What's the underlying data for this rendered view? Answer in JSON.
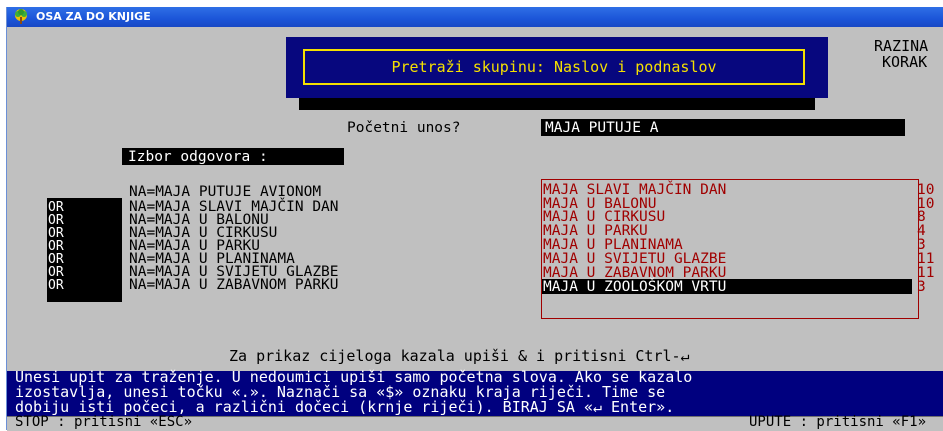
{
  "window": {
    "title": "OSA ZA DO KNJIGE"
  },
  "header": {
    "title": "Pretraži skupinu: Naslov i podnaslov",
    "right_label_1": "RAZINA",
    "right_label_2": "KORAK"
  },
  "input": {
    "label": "Početni unos?",
    "value": "MAJA PUTUJE A"
  },
  "choice": {
    "title": "Izbor odgovora :"
  },
  "terms": [
    {
      "op": "",
      "text": "NA=MAJA PUTUJE AVIONOM"
    },
    {
      "op": "OR",
      "text": "NA=MAJA SLAVI MAJČIN DAN"
    },
    {
      "op": "OR",
      "text": "NA=MAJA U BALONU"
    },
    {
      "op": "OR",
      "text": "NA=MAJA U CIRKUSU"
    },
    {
      "op": "OR",
      "text": "NA=MAJA U PARKU"
    },
    {
      "op": "OR",
      "text": "NA=MAJA U PLANINAMA"
    },
    {
      "op": "OR",
      "text": "NA=MAJA U SVIJETU GLAZBE"
    },
    {
      "op": "OR",
      "text": "NA=MAJA U ZABAVNOM PARKU"
    }
  ],
  "results": [
    {
      "title": "MAJA SLAVI MAJČIN DAN",
      "count": "10"
    },
    {
      "title": "MAJA U BALONU",
      "count": "10"
    },
    {
      "title": "MAJA U CIRKUSU",
      "count": "8"
    },
    {
      "title": "MAJA U PARKU",
      "count": "4"
    },
    {
      "title": "MAJA U PLANINAMA",
      "count": "3"
    },
    {
      "title": "MAJA U SVIJETU GLAZBE",
      "count": "11"
    },
    {
      "title": "MAJA U ZABAVNOM PARKU",
      "count": "11"
    },
    {
      "title": "MAJA U ZOOLOŠKOM VRTU",
      "count": "3"
    }
  ],
  "hint": "Za prikaz cijeloga kazala upiši & i pritisni Ctrl-↵",
  "help": {
    "line1": "Unesi upit za traženje. U nedoumici upiši samo početna slova. Ako se kazalo",
    "line2": "izostavlja, unesi točku «.». Naznači sa «$» oznaku kraja riječi. Time se",
    "line3": "dobiju isti počeci, a različni dočeci (krnje riječi). BIRAJ SA «↵ Enter»."
  },
  "footer": {
    "left": "STOP : pritisni «ESC»",
    "right": "UPUTE : pritisni «F1»"
  },
  "colors": {
    "header_bg": "#07077e",
    "header_text": "#f5e000",
    "status_bg": "#00007f",
    "result_text": "#a00000"
  }
}
